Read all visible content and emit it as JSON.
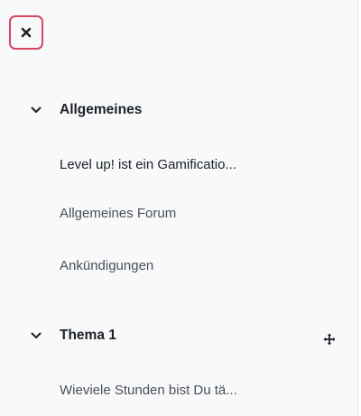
{
  "close_button": {
    "icon": "close-icon"
  },
  "sections": [
    {
      "title": "Allgemeines",
      "expanded": true,
      "items": [
        {
          "label": "Level up! ist ein Gamificatio..."
        },
        {
          "label": "Allgemeines Forum"
        },
        {
          "label": "Ankündigungen"
        }
      ]
    },
    {
      "title": "Thema 1",
      "expanded": true,
      "move_icon": "move-icon",
      "items": [
        {
          "label": "Wieviele Stunden bist Du tä..."
        }
      ]
    }
  ],
  "colors": {
    "focus_ring": "#d9455f",
    "drawer_bg": "#f8f9fa",
    "text": "#1d2125"
  }
}
